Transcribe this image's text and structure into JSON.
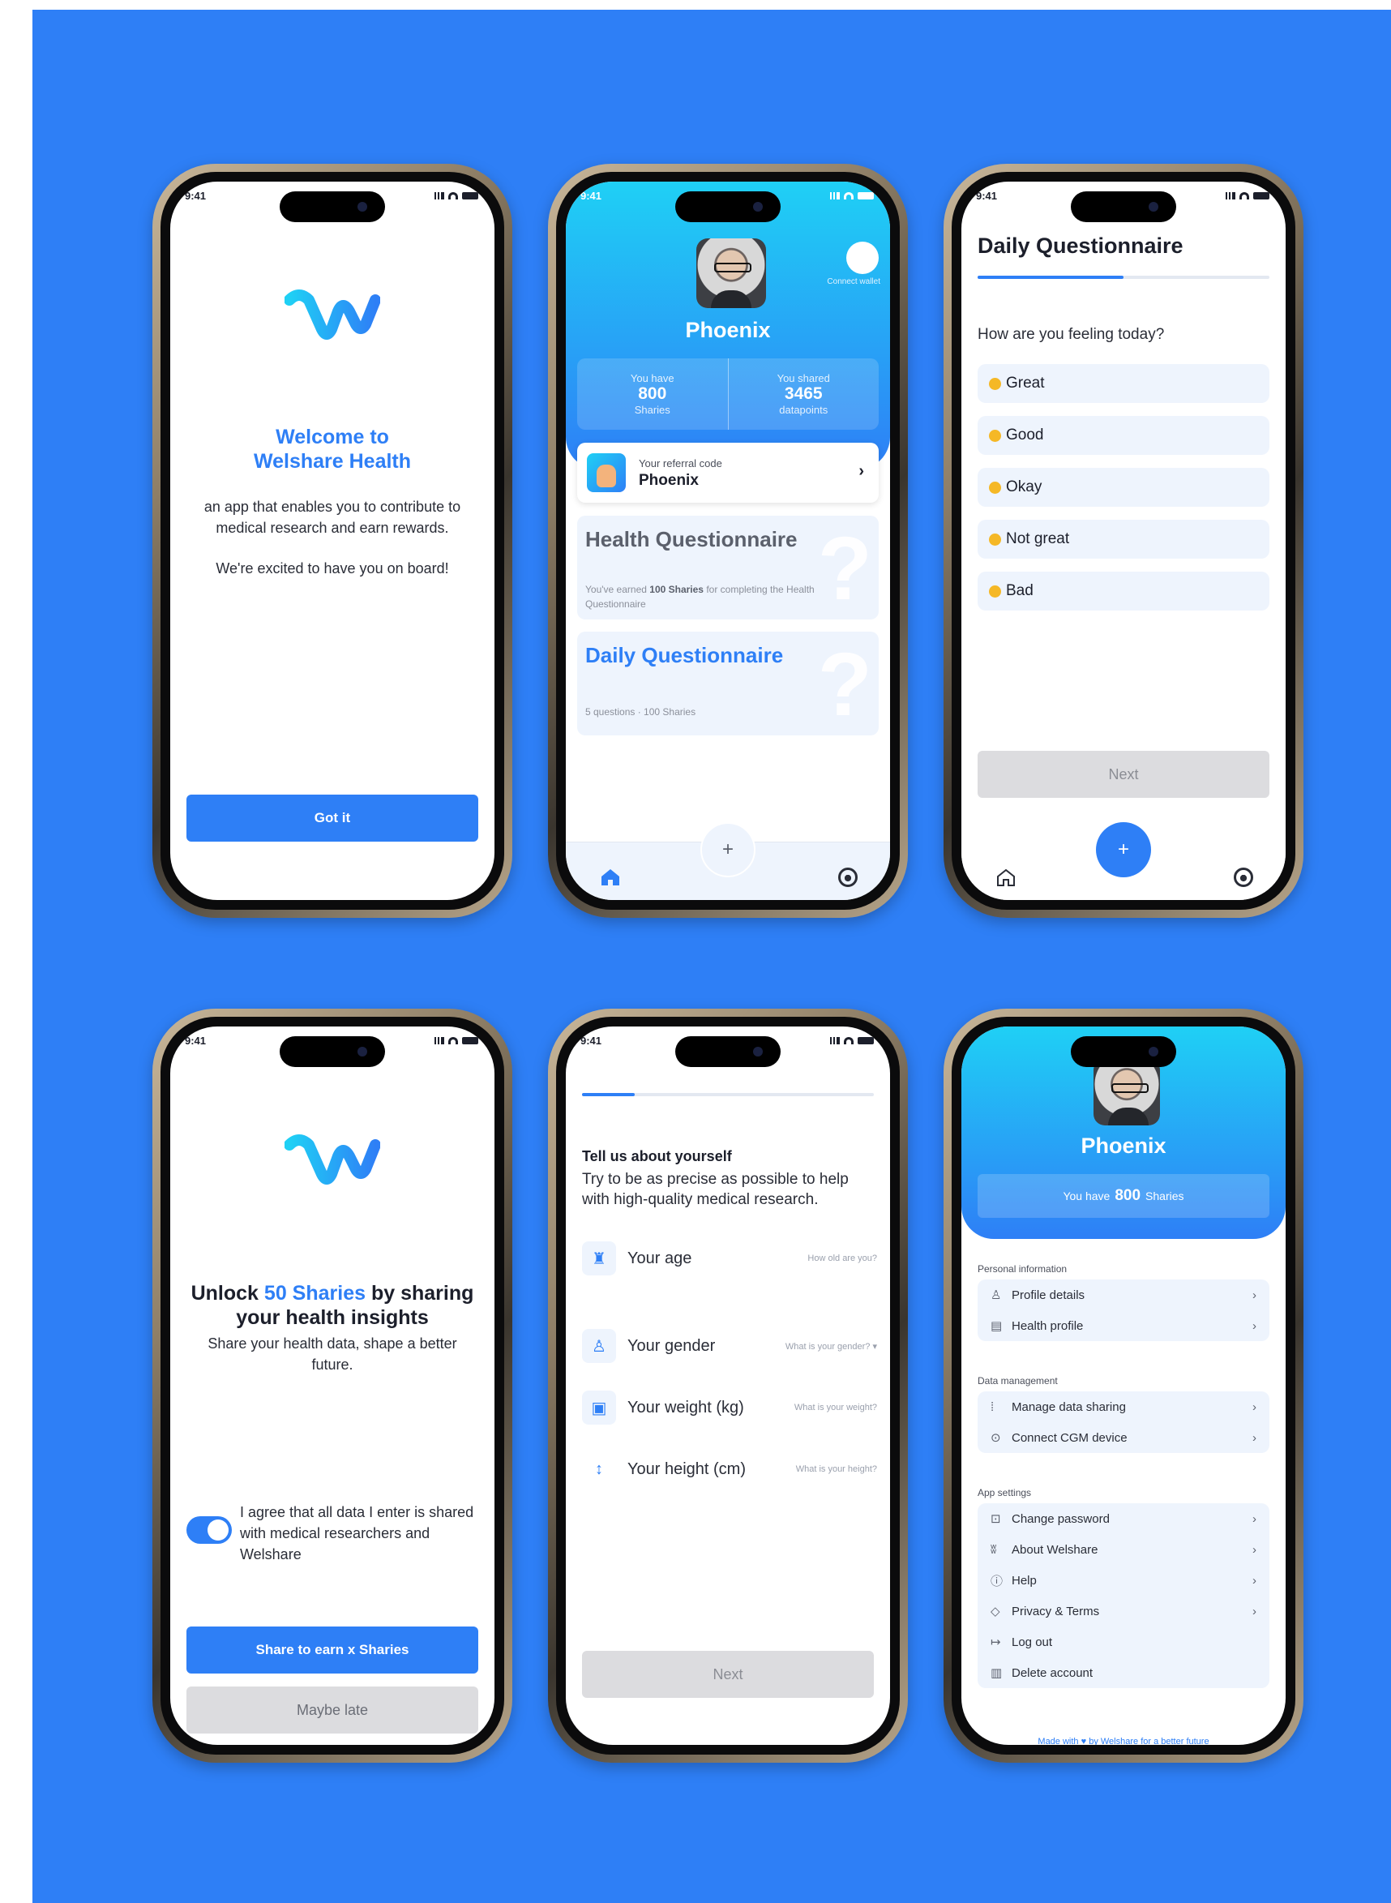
{
  "status_time": "9:41",
  "phone1": {
    "welcome_line1": "Welcome to",
    "welcome_line2": "Welshare Health",
    "desc": "an app that enables you to contribute to medical research and earn rewards.",
    "excited": "We're excited to have you on board!",
    "button": "Got it"
  },
  "phone2": {
    "name": "Phoenix",
    "connect_wallet": "Connect wallet",
    "stat1_top": "You have",
    "stat1_value": "800",
    "stat1_unit": "Sharies",
    "stat2_top": "You shared",
    "stat2_value": "3465",
    "stat2_unit": "datapoints",
    "ref_label": "Your referral code",
    "ref_code": "Phoenix",
    "health_title": "Health Questionnaire",
    "health_desc_prefix": "You've earned",
    "health_desc_bold": "100 Sharies",
    "health_desc_suffix": "for completing the Health Questionnaire",
    "daily_title": "Daily Questionnaire",
    "daily_desc": "5 questions · 100 Sharies"
  },
  "phone3": {
    "title": "Daily Questionnaire",
    "progress": 0.5,
    "question": "How are you feeling today?",
    "options": [
      "Great",
      "Good",
      "Okay",
      "Not great",
      "Bad"
    ],
    "button": "Next"
  },
  "phone4": {
    "unlock_prefix": "Unlock",
    "unlock_highlight": "50 Sharies",
    "unlock_suffix": "by sharing",
    "unlock_line2": "your health insights",
    "subtitle": "Share your health data, shape a better future.",
    "consent": "I agree that all data I enter is shared with medical researchers and Welshare",
    "consent_on": true,
    "share_button": "Share to earn x Sharies",
    "maybe_button": "Maybe late"
  },
  "phone5": {
    "progress": 0.18,
    "heading": "Tell us about yourself",
    "sub": "Try to be as precise as possible to help with high-quality medical research.",
    "fields": [
      {
        "label": "Your age",
        "placeholder": "How old are you?",
        "icon": "cake-icon"
      },
      {
        "label": "Your gender",
        "placeholder": "What is your gender? ▾",
        "icon": "person-icon"
      },
      {
        "label": "Your weight (kg)",
        "placeholder": "What is your weight?",
        "icon": "scale-icon"
      },
      {
        "label": "Your height (cm)",
        "placeholder": "What is your height?",
        "icon": "height-icon"
      }
    ],
    "button": "Next"
  },
  "phone6": {
    "name": "Phoenix",
    "have_prefix": "You have",
    "have_value": "800",
    "have_suffix": "Sharies",
    "personal_title": "Personal information",
    "personal_items": [
      "Profile details",
      "Health profile"
    ],
    "data_title": "Data management",
    "data_items": [
      "Manage data sharing",
      "Connect CGM device"
    ],
    "app_title": "App settings",
    "app_items": [
      "Change password",
      "About Welshare",
      "Help",
      "Privacy & Terms",
      "Log out",
      "Delete account"
    ],
    "footer_prefix": "Made with",
    "footer_suffix": "by Welshare for a better future"
  },
  "colors": {
    "background": "#2e7ff6",
    "accent": "#2e7ff6",
    "gradient_top": "#1fd0f5",
    "card": "#eef4fd",
    "disabled": "#dcdcdf"
  }
}
